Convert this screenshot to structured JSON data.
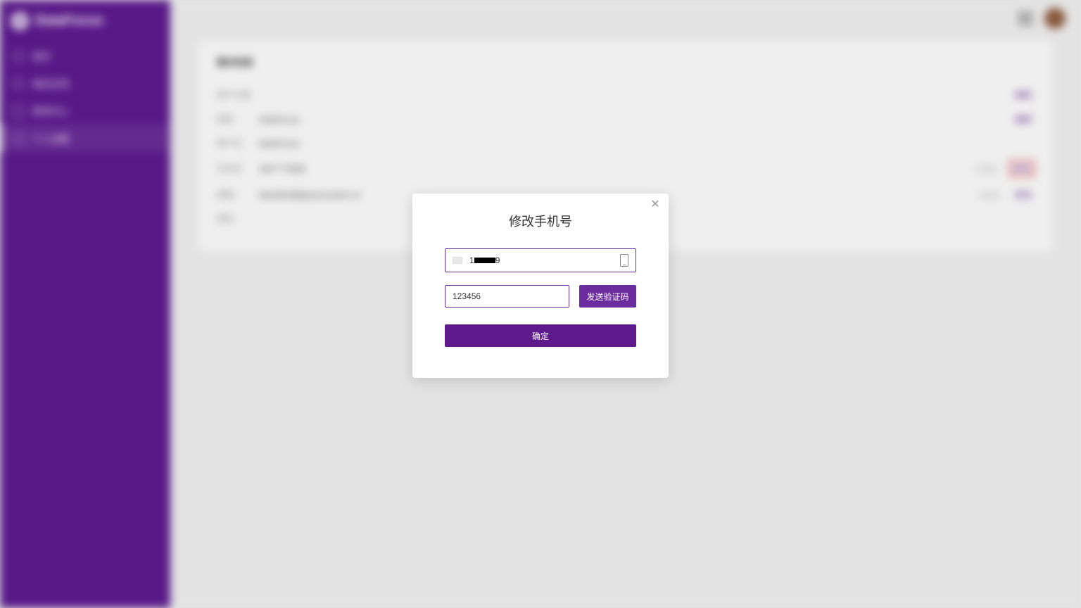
{
  "app": {
    "name": "DataFocus"
  },
  "sidebar": {
    "items": [
      {
        "label": "首页"
      },
      {
        "label": "我的应用"
      },
      {
        "label": "费用中心"
      },
      {
        "label": "个人设置"
      }
    ]
  },
  "card": {
    "title": "基本信息",
    "rows": [
      {
        "label": "用户头像",
        "value": "",
        "action": "编辑"
      },
      {
        "label": "昵称",
        "value": "DataFocus",
        "action": "编辑"
      },
      {
        "label": "用户名",
        "value": "DataFocus",
        "action": ""
      },
      {
        "label": "手机号",
        "value": "182****5268",
        "extra": "已验证",
        "action": "修改",
        "hl": true
      },
      {
        "label": "邮箱",
        "value": "blackbird8@yourcustom.cn",
        "extra": "已验证",
        "action": "修改"
      },
      {
        "label": "密码",
        "value": "",
        "action": ""
      }
    ]
  },
  "modal": {
    "title": "修改手机号",
    "phone_prefix": "1",
    "phone_suffix": "9",
    "code_value": "123456",
    "send_label": "发送验证码",
    "confirm_label": "确定"
  }
}
